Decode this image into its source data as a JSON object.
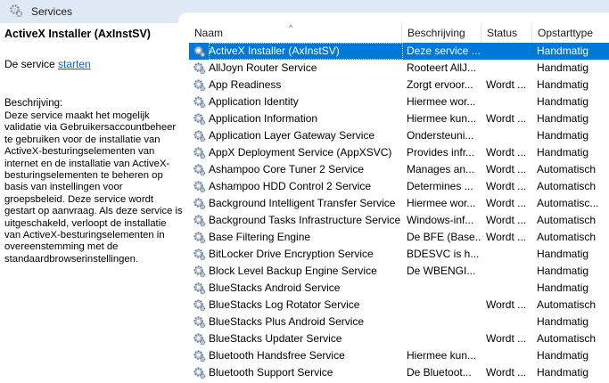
{
  "window": {
    "title": "Services"
  },
  "left_panel": {
    "service_name": "ActiveX Installer (AxInstSV)",
    "action_prefix": "De service ",
    "action_link": "starten",
    "description_label": "Beschrijving:",
    "description": "Deze service maakt het mogelijk validatie via Gebruikersaccountbeheer te gebruiken voor de installatie van ActiveX-besturingselementen van internet en de installatie van ActiveX-besturingselementen te beheren op basis van instellingen voor groepsbeleid. Deze service wordt gestart op aanvraag. Als deze service is uitgeschakeld, verloopt de installatie van ActiveX-besturingselementen in overeenstemming met de standaardbrowserinstellingen."
  },
  "table": {
    "columns": {
      "name": "Naam",
      "description": "Beschrijving",
      "status": "Status",
      "startup": "Opstarttype"
    },
    "sort_indicator": "^",
    "rows": [
      {
        "name": "ActiveX Installer (AxInstSV)",
        "description": "Deze service ...",
        "status": "",
        "startup": "Handmatig",
        "selected": true
      },
      {
        "name": "AllJoyn Router Service",
        "description": "Rooteert AllJ...",
        "status": "",
        "startup": "Handmatig"
      },
      {
        "name": "App Readiness",
        "description": "Zorgt ervoor...",
        "status": "Wordt ...",
        "startup": "Handmatig"
      },
      {
        "name": "Application Identity",
        "description": "Hiermee wor...",
        "status": "",
        "startup": "Handmatig"
      },
      {
        "name": "Application Information",
        "description": "Hiermee kun...",
        "status": "Wordt ...",
        "startup": "Handmatig"
      },
      {
        "name": "Application Layer Gateway Service",
        "description": "Ondersteuni...",
        "status": "",
        "startup": "Handmatig"
      },
      {
        "name": "AppX Deployment Service (AppXSVC)",
        "description": "Provides infr...",
        "status": "Wordt ...",
        "startup": "Handmatig"
      },
      {
        "name": "Ashampoo Core Tuner 2 Service",
        "description": "Manages an...",
        "status": "Wordt ...",
        "startup": "Automatisch"
      },
      {
        "name": "Ashampoo HDD Control 2 Service",
        "description": "Determines ...",
        "status": "Wordt ...",
        "startup": "Automatisch"
      },
      {
        "name": "Background Intelligent Transfer Service",
        "description": "Hiermee wor...",
        "status": "Wordt ...",
        "startup": "Automatisc..."
      },
      {
        "name": "Background Tasks Infrastructure Service",
        "description": "Windows-inf...",
        "status": "Wordt ...",
        "startup": "Automatisch"
      },
      {
        "name": "Base Filtering Engine",
        "description": "De BFE (Base...",
        "status": "Wordt ...",
        "startup": "Automatisch"
      },
      {
        "name": "BitLocker Drive Encryption Service",
        "description": "BDESVC is h...",
        "status": "",
        "startup": "Handmatig"
      },
      {
        "name": "Block Level Backup Engine Service",
        "description": "De WBENGI...",
        "status": "",
        "startup": "Handmatig"
      },
      {
        "name": "BlueStacks Android Service",
        "description": "",
        "status": "",
        "startup": "Handmatig"
      },
      {
        "name": "BlueStacks Log Rotator Service",
        "description": "",
        "status": "Wordt ...",
        "startup": "Automatisch"
      },
      {
        "name": "BlueStacks Plus Android Service",
        "description": "",
        "status": "",
        "startup": "Handmatig"
      },
      {
        "name": "BlueStacks Updater Service",
        "description": "",
        "status": "Wordt ...",
        "startup": "Automatisch"
      },
      {
        "name": "Bluetooth Handsfree Service",
        "description": "Hiermee kun...",
        "status": "",
        "startup": "Handmatig"
      },
      {
        "name": "Bluetooth Support Service",
        "description": "De Bluetoot...",
        "status": "Wordt ...",
        "startup": "Handmatig"
      }
    ]
  },
  "colors": {
    "selection": "#0078d7",
    "link": "#0066cc",
    "titlebar": "#dfe9f5"
  }
}
